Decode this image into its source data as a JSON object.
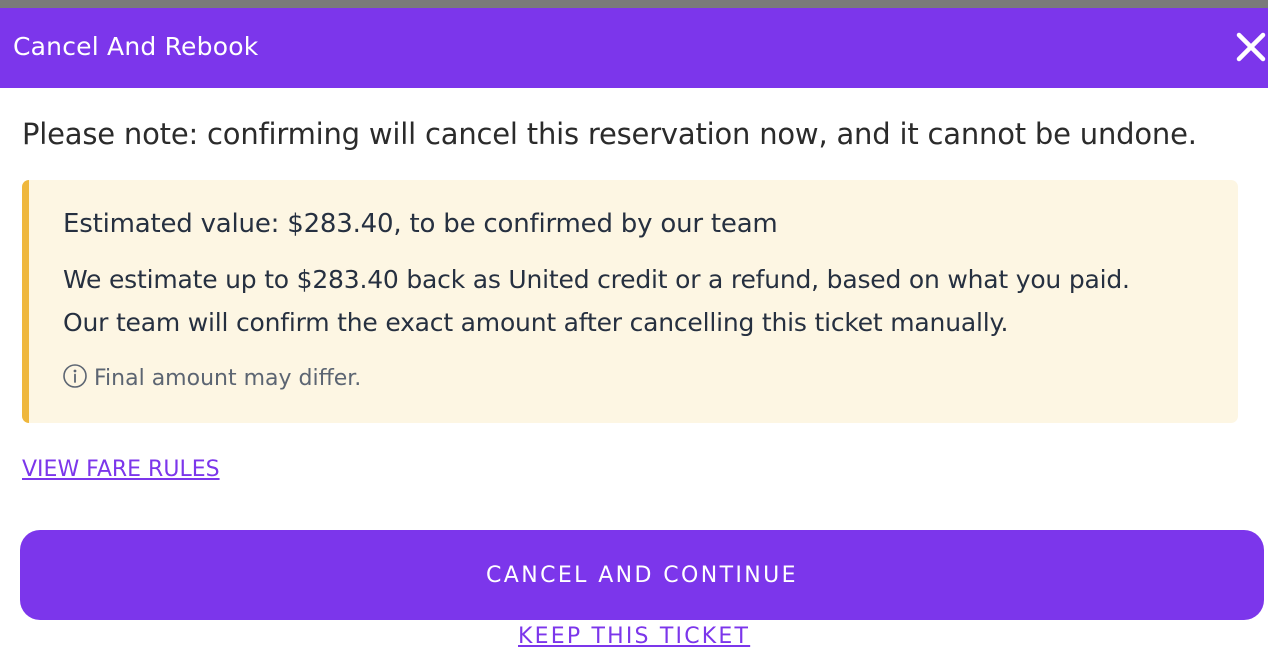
{
  "dialog": {
    "title": "Cancel And Rebook",
    "close_icon": "close-icon"
  },
  "notice": "Please note: confirming will cancel this reservation now, and it cannot be undone.",
  "estimate_box": {
    "title": "Estimated value: $283.40, to be confirmed by our team",
    "line1": "We estimate up to $283.40 back as United credit or a refund, based on what you paid.",
    "line2": "Our team will confirm the exact amount after cancelling this ticket manually.",
    "hint_icon": "info-icon",
    "hint": "Final amount may differ.",
    "accent_color": "#efb73c",
    "background_color": "#fdf6e3"
  },
  "fare_rules_link": "VIEW FARE RULES",
  "primary_button": "CANCEL AND CONTINUE",
  "secondary_link": "KEEP THIS TICKET",
  "colors": {
    "brand": "#7c36eb",
    "text": "#2b2b2b"
  }
}
